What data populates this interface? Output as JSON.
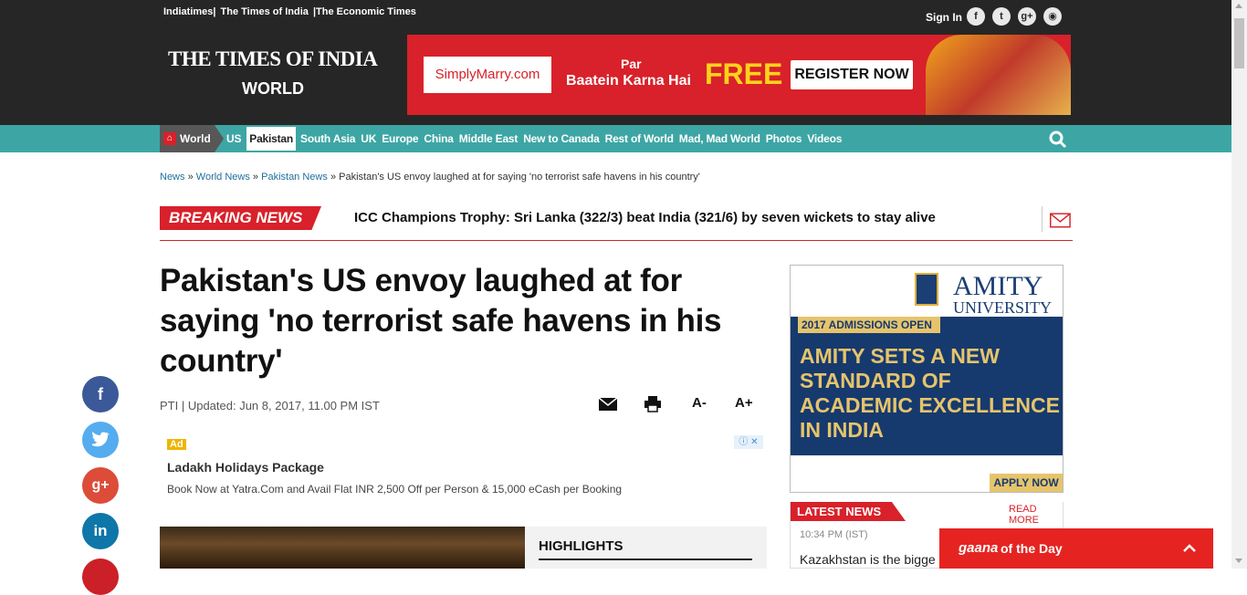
{
  "header": {
    "top_links": [
      "Indiatimes|",
      "The Times of India",
      "|The Economic Times"
    ],
    "sign_in": "Sign In",
    "social_icons": [
      "facebook-icon",
      "twitter-icon",
      "google-plus-icon",
      "rss-icon"
    ],
    "logo": "THE TIMES OF INDIA",
    "section": "WORLD"
  },
  "banner_ad": {
    "brand": "SimplyMarry.com",
    "line1": "Par",
    "line2": "Baatein Karna Hai",
    "free": "FREE",
    "cta": "REGISTER NOW"
  },
  "nav": {
    "home_label": "World",
    "items": [
      "US",
      "Pakistan",
      "South Asia",
      "UK",
      "Europe",
      "China",
      "Middle East",
      "New to Canada",
      "Rest of World",
      "Mad, Mad World",
      "Photos",
      "Videos"
    ],
    "active": "Pakistan"
  },
  "breadcrumb": {
    "items": [
      "News",
      "World News",
      "Pakistan News"
    ],
    "separator": "»",
    "current": "Pakistan's US envoy laughed at for saying 'no terrorist safe havens in his country'"
  },
  "breaking": {
    "label": "BREAKING NEWS",
    "text": "ICC Champions Trophy: Sri Lanka (322/3) beat India (321/6) by seven wickets to stay alive"
  },
  "article": {
    "headline": "Pakistan's US envoy laughed at for saying 'no terrorist safe havens in his country'",
    "byline": "PTI | Updated: Jun 8, 2017, 11.00 PM IST",
    "tools": {
      "font_decrease": "A-",
      "font_increase": "A+"
    }
  },
  "inline_ad": {
    "badge": "Ad",
    "title": "Ladakh Holidays Package",
    "desc": "Book Now at Yatra.Com and Avail Flat INR 2,500 Off per Person & 15,000 eCash per Booking",
    "close": "ⓘ ✕"
  },
  "highlights": {
    "title": "HIGHLIGHTS"
  },
  "side_share": [
    "f",
    "twitter",
    "g+",
    "in",
    ""
  ],
  "sidebar_ad": {
    "brand": "AMITY",
    "brand_sub": "UNIVERSITY",
    "admissions": "2017 ADMISSIONS OPEN",
    "headline": "AMITY SETS A NEW STANDARD OF ACADEMIC EXCELLENCE IN INDIA",
    "cta": "APPLY NOW"
  },
  "latest_news": {
    "label": "LATEST NEWS",
    "more": "READ MORE",
    "time": "10:34 PM (IST)",
    "story": "Kazakhstan is the bigge"
  },
  "gaana": {
    "logo": "gaana",
    "label": "of the Day"
  },
  "colors": {
    "nav_bg": "#3da6a4",
    "brand_red": "#d8212a",
    "topbar_bg": "#262626"
  }
}
